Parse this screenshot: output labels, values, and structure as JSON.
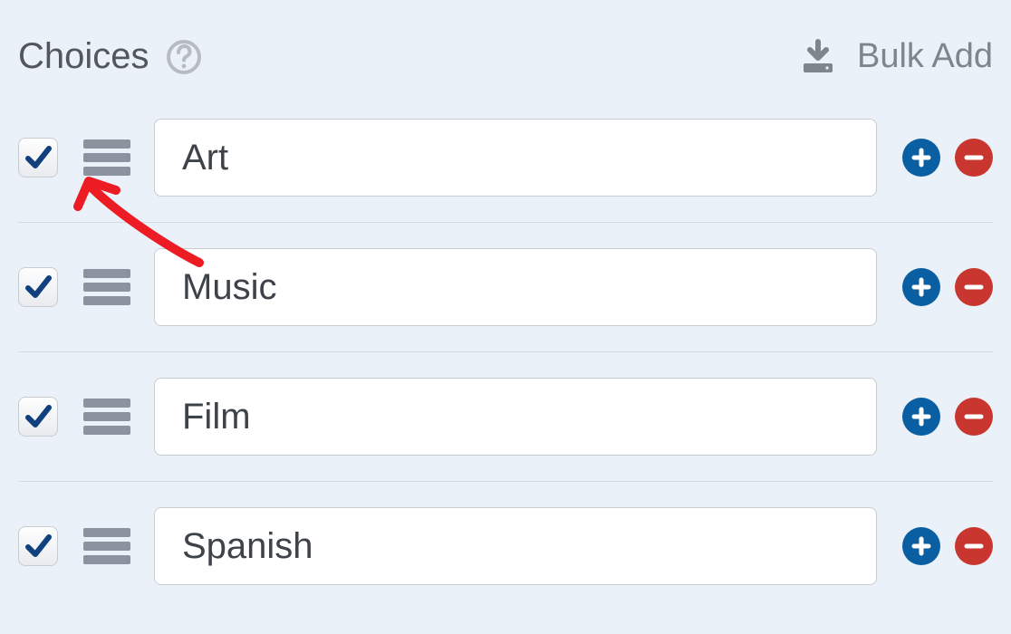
{
  "header": {
    "title": "Choices",
    "bulk_add": "Bulk Add"
  },
  "rows": [
    {
      "checked": true,
      "value": "Art"
    },
    {
      "checked": true,
      "value": "Music"
    },
    {
      "checked": true,
      "value": "Film"
    },
    {
      "checked": true,
      "value": "Spanish"
    }
  ],
  "colors": {
    "add": "#0a5fa3",
    "remove": "#c8362f",
    "handle": "#8a939e",
    "check": "#10407d",
    "arrow": "#ed1c24"
  }
}
